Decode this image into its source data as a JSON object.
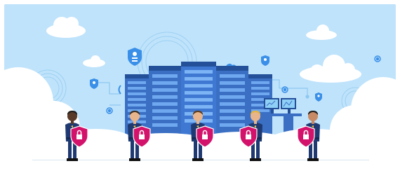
{
  "scene": {
    "colors": {
      "sky": "#bfe3fb",
      "cloud": "#ffffff",
      "server_body": "#3a6fc4",
      "server_light": "#6fa8ef",
      "server_dark": "#24509a",
      "uniform": "#1f3a72",
      "shield": "#d3136b",
      "icon_badge": "#3a8fe8",
      "lines": "#8ec8f0"
    },
    "guards": [
      {
        "name": "guard-1",
        "skin": "#5a3a28",
        "hair": "#1a1a1a"
      },
      {
        "name": "guard-2",
        "skin": "#e8b48c",
        "hair": "#3a2a1a"
      },
      {
        "name": "guard-3",
        "skin": "#e8b48c",
        "hair": "#5a3a1a"
      },
      {
        "name": "guard-4",
        "skin": "#e8b48c",
        "hair": "#e5b53a"
      },
      {
        "name": "guard-5",
        "skin": "#c88a64",
        "hair": "#1a1a1a"
      }
    ]
  }
}
